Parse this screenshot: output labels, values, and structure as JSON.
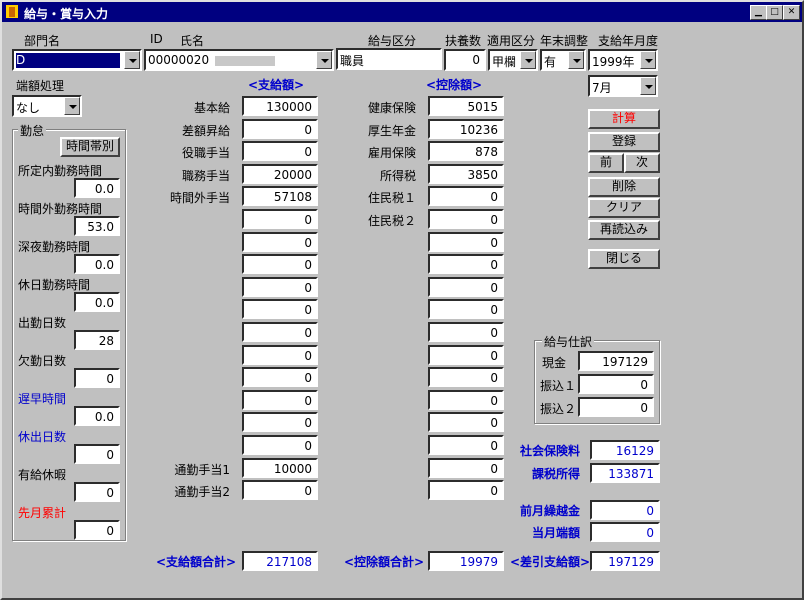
{
  "window": {
    "title": "給与・賞与入力"
  },
  "header": {
    "dept_label": "部門名",
    "id_label": "ID",
    "name_label": "氏名",
    "kubun_label": "給与区分",
    "fuyo_label": "扶養数",
    "tekiyo_label": "適用区分",
    "nenmatsu_label": "年末調整",
    "nengetsu_label": "支給年月度",
    "dept_value": "D",
    "id_name_value": "00000020",
    "kubun_value": "職員",
    "fuyo_value": "0",
    "tekiyo_value": "甲欄",
    "nenmatsu_value": "有",
    "year_value": "1999年",
    "month_value": "7月"
  },
  "rounding": {
    "label": "端額処理",
    "value": "なし"
  },
  "attendance": {
    "title": "勤怠",
    "hourly_button": "時間帯別",
    "items": [
      {
        "label": "所定内勤務時間",
        "value": "0.0"
      },
      {
        "label": "時間外勤務時間",
        "value": "53.0"
      },
      {
        "label": "深夜勤務時間",
        "value": "0.0"
      },
      {
        "label": "休日勤務時間",
        "value": "0.0"
      },
      {
        "label": "出勤日数",
        "value": "28"
      },
      {
        "label": "欠勤日数",
        "value": "0"
      },
      {
        "label": "遅早時間",
        "value": "0.0"
      },
      {
        "label": "休出日数",
        "value": "0"
      },
      {
        "label": "有給休暇",
        "value": "0"
      },
      {
        "label": "先月累計",
        "value": "0"
      }
    ]
  },
  "payments": {
    "header": "<支給額>",
    "labels": [
      "基本給",
      "差額昇給",
      "役職手当",
      "職務手当",
      "時間外手当"
    ],
    "values": [
      "130000",
      "0",
      "0",
      "20000",
      "57108",
      "0",
      "0",
      "0",
      "0",
      "0",
      "0",
      "0",
      "0",
      "0",
      "0",
      "0",
      "10000",
      "0"
    ],
    "bottom_labels": [
      "通勤手当1",
      "通勤手当2"
    ],
    "total_label": "<支給額合計>",
    "total_value": "217108"
  },
  "deductions": {
    "header": "<控除額>",
    "labels": [
      "健康保険",
      "厚生年金",
      "雇用保険",
      "所得税",
      "住民税１",
      "住民税２"
    ],
    "values": [
      "5015",
      "10236",
      "878",
      "3850",
      "0",
      "0",
      "0",
      "0",
      "0",
      "0",
      "0",
      "0",
      "0",
      "0",
      "0",
      "0",
      "0",
      "0"
    ],
    "total_label": "<控除額合計>",
    "total_value": "19979"
  },
  "buttons": {
    "calc": "計算",
    "register": "登録",
    "prev": "前",
    "next": "次",
    "delete": "削除",
    "clear": "クリア",
    "reload": "再読込み",
    "close": "閉じる"
  },
  "breakdown": {
    "title": "給与仕訳",
    "cash_label": "現金",
    "cash_value": "197129",
    "transfer1_label": "振込１",
    "transfer1_value": "0",
    "transfer2_label": "振込２",
    "transfer2_value": "0"
  },
  "summary": {
    "social_label": "社会保険料",
    "social_value": "16129",
    "taxable_label": "課税所得",
    "taxable_value": "133871",
    "carry_label": "前月繰越金",
    "carry_value": "0",
    "month_end_label": "当月端額",
    "month_end_value": "0",
    "net_label": "<差引支給額>",
    "net_value": "197129"
  }
}
